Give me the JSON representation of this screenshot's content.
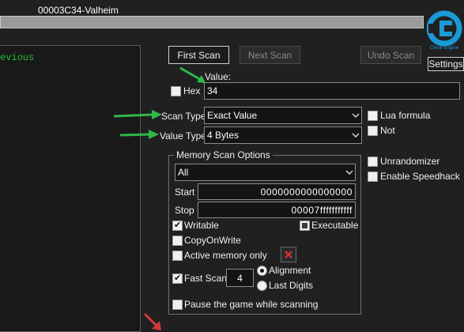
{
  "window": {
    "title": "00003C34-Valheim"
  },
  "logo": {
    "label": "Settings",
    "caption": "Cheat Engine"
  },
  "results": {
    "partial_column": "evious"
  },
  "buttons": {
    "first_scan": "First Scan",
    "next_scan": "Next Scan",
    "undo_scan": "Undo Scan"
  },
  "value": {
    "label": "Value:",
    "hex_label": "Hex",
    "hex_checked": false,
    "input": "34"
  },
  "scan_type": {
    "label": "Scan Type",
    "selected": "Exact Value"
  },
  "value_type": {
    "label": "Value Type",
    "selected": "4 Bytes"
  },
  "options_right": {
    "lua_formula": "Lua formula",
    "not": "Not",
    "unrandomizer": "Unrandomizer",
    "enable_speedhack": "Enable Speedhack"
  },
  "memory": {
    "title": "Memory Scan Options",
    "region": "All",
    "start_label": "Start",
    "start_value": "0000000000000000",
    "stop_label": "Stop",
    "stop_value": "00007fffffffffff",
    "writable": "Writable",
    "writable_checked": true,
    "executable": "Executable",
    "executable_state": "indeterminate",
    "copy_on_write": "CopyOnWrite",
    "active_memory_only": "Active memory only",
    "fast_scan": "Fast Scan",
    "fast_scan_checked": true,
    "fast_scan_value": "4",
    "alignment": "Alignment",
    "last_digits": "Last Digits",
    "pause": "Pause the game while scanning"
  },
  "colors": {
    "annotation_arrow": "#2db84a",
    "results_text": "#1fbf3a",
    "clear_icon": "#e03030"
  },
  "icons": [
    "cheat-engine-logo",
    "chevron-down-icon",
    "red-x-icon",
    "red-arrow-icon",
    "green-arrow-icon"
  ]
}
